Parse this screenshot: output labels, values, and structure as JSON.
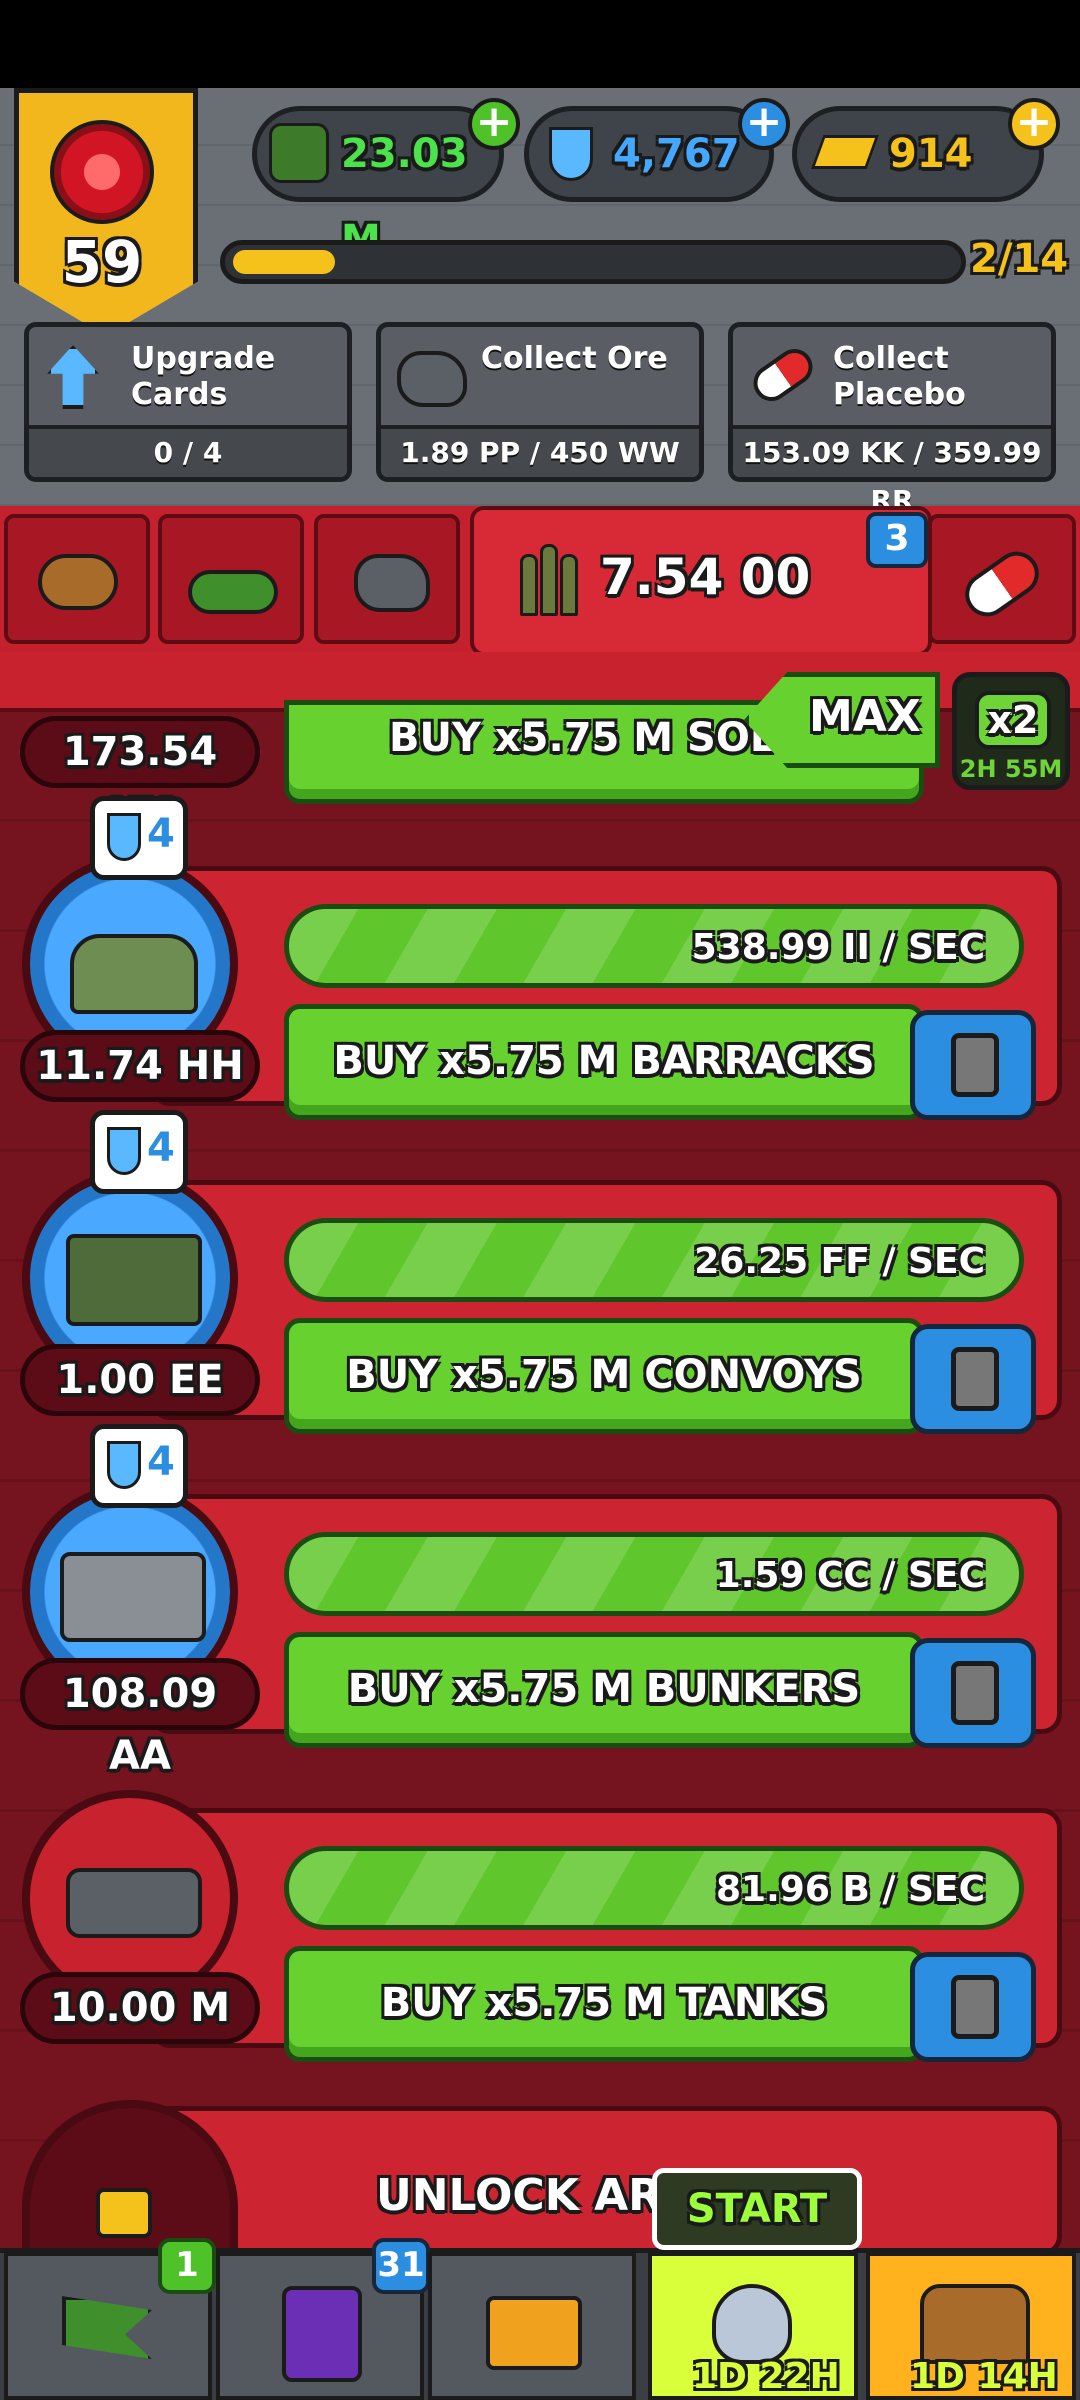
{
  "hud": {
    "level": "59",
    "soldiers": "23.03 M",
    "science": "4,767",
    "gold": "914",
    "xp_progress": "2/14",
    "xp_fraction": 0.14
  },
  "tasks": [
    {
      "label": "Upgrade\nCards",
      "progress": "0 / 4"
    },
    {
      "label": "Collect Ore",
      "progress": "1.89 PP / 450 WW"
    },
    {
      "label": "Collect\nPlacebo",
      "progress": "153.09 KK / 359.99 RR"
    }
  ],
  "tabs": {
    "ammo_value": "7.54 00",
    "badge": "3"
  },
  "controls": {
    "max_label": "MAX",
    "boost_label": "x2",
    "boost_timer": "2H 55M"
  },
  "units": [
    {
      "count": "173.54 KK",
      "buy": "BUY x5.75 M SOLD",
      "flask": "",
      "rate": ""
    },
    {
      "count": "11.74 HH",
      "buy": "BUY x5.75 M BARRACKS",
      "flask": "4",
      "rate": "538.99 II / SEC"
    },
    {
      "count": "1.00 EE",
      "buy": "BUY x5.75 M CONVOYS",
      "flask": "4",
      "rate": "26.25 FF / SEC"
    },
    {
      "count": "108.09 AA",
      "buy": "BUY x5.75 M BUNKERS",
      "flask": "4",
      "rate": "1.59 CC / SEC"
    },
    {
      "count": "10.00 M",
      "buy": "BUY x5.75 M TANKS",
      "flask": "",
      "rate": "81.96 B / SEC"
    }
  ],
  "unlock": {
    "label": "UNLOCK ART"
  },
  "nav": {
    "missions_badge": "1",
    "cards_badge": "31",
    "start_label": "START",
    "event_timer": "1D 22H",
    "chest_timer": "1D 14H"
  },
  "colors": {
    "bg_red": "#75131f",
    "panel_red": "#cc2430",
    "buy_green": "#67d22f",
    "gold": "#f5c21b",
    "blue": "#2c8ee0"
  }
}
